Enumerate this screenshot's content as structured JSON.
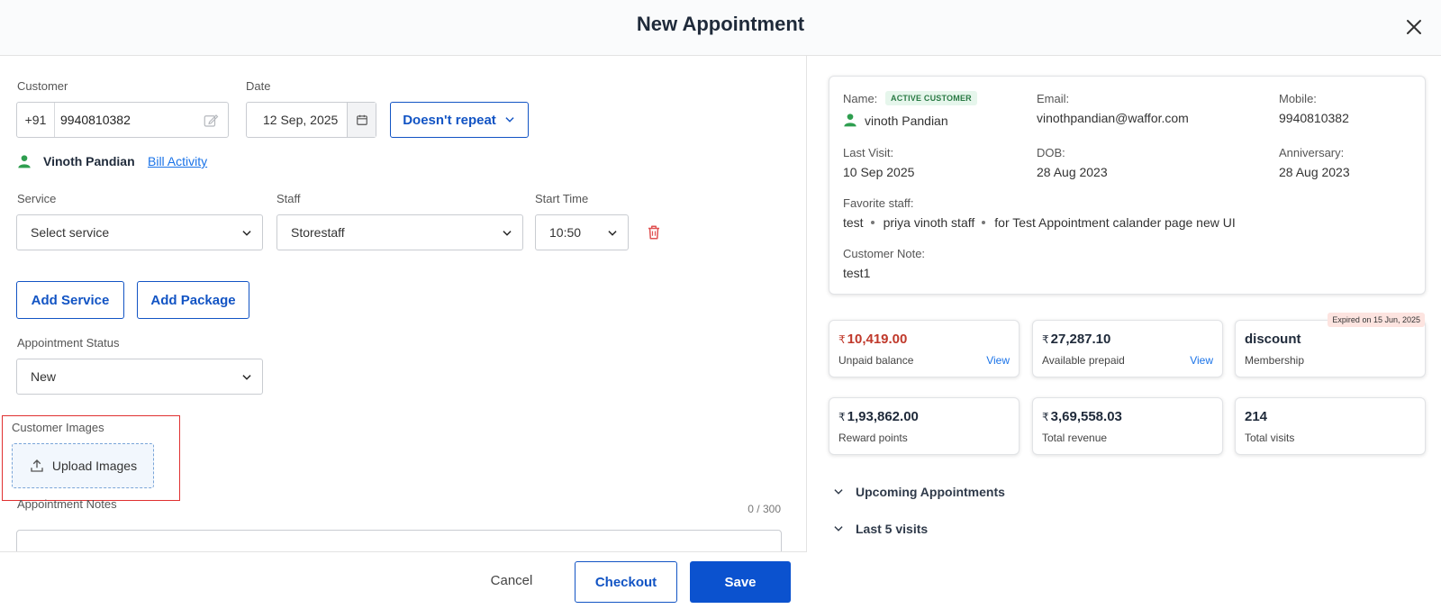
{
  "header": {
    "title": "New Appointment"
  },
  "form": {
    "customer_label": "Customer",
    "phone_prefix": "+91",
    "phone_value": "9940810382",
    "date_label": "Date",
    "date_value": "12 Sep, 2025",
    "repeat_label": "Doesn't repeat",
    "customer_name": "Vinoth Pandian",
    "bill_activity": "Bill Activity",
    "service_label": "Service",
    "service_value": "Select service",
    "staff_label": "Staff",
    "staff_value": "Storestaff",
    "start_time_label": "Start Time",
    "start_time_value": "10:50",
    "add_service": "Add Service",
    "add_package": "Add Package",
    "status_label": "Appointment Status",
    "status_value": "New",
    "images_label": "Customer Images",
    "upload_label": "Upload Images",
    "notes_label": "Appointment Notes",
    "notes_counter": "0 / 300",
    "notes_value": ""
  },
  "footer": {
    "cancel": "Cancel",
    "checkout": "Checkout",
    "save": "Save"
  },
  "profile": {
    "name_label": "Name:",
    "status_badge": "ACTIVE CUSTOMER",
    "name_value": "vinoth Pandian",
    "email_label": "Email:",
    "email_value": "vinothpandian@waffor.com",
    "mobile_label": "Mobile:",
    "mobile_value": "9940810382",
    "last_visit_label": "Last Visit:",
    "last_visit_value": "10 Sep 2025",
    "dob_label": "DOB:",
    "dob_value": "28 Aug 2023",
    "anniversary_label": "Anniversary:",
    "anniversary_value": "28 Aug 2023",
    "favorite_staff_label": "Favorite staff:",
    "favorite_staff": [
      "test",
      "priya vinoth staff",
      "for Test Appointment calander page new UI"
    ],
    "note_label": "Customer Note:",
    "note_value": "test1"
  },
  "stats": {
    "unpaid": {
      "amount": "10,419.00",
      "label": "Unpaid balance",
      "link": "View"
    },
    "prepaid": {
      "amount": "27,287.10",
      "label": "Available prepaid",
      "link": "View"
    },
    "membership": {
      "amount": "discount",
      "label": "Membership",
      "expiry": "Expired on 15 Jun, 2025"
    },
    "reward": {
      "amount": "1,93,862.00",
      "label": "Reward points"
    },
    "revenue": {
      "amount": "3,69,558.03",
      "label": "Total revenue"
    },
    "visits": {
      "amount": "214",
      "label": "Total visits"
    },
    "currency_symbol": "₹"
  },
  "accordions": {
    "upcoming": "Upcoming Appointments",
    "last_visits": "Last 5 visits"
  },
  "colors": {
    "primary": "#0b52cf",
    "unpaid": "#c0392b",
    "active_badge_bg": "#e6f6ec",
    "person_icon": "#2e9e4f",
    "highlight_border": "#e03030"
  }
}
